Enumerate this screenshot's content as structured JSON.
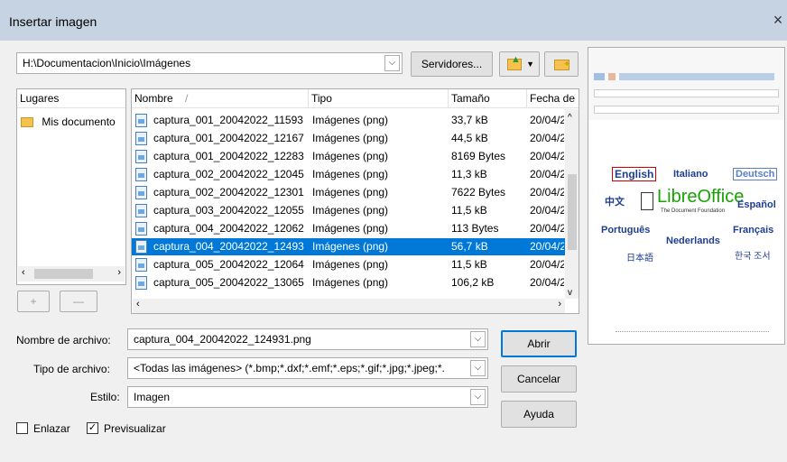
{
  "window": {
    "title": "Insertar imagen",
    "close_glyph": "×"
  },
  "path": {
    "value": "H:\\Documentacion\\Inicio\\Imágenes",
    "servers_button": "Servidores..."
  },
  "places": {
    "header": "Lugares",
    "items": [
      "Mis documento"
    ],
    "add": "+",
    "remove": "—"
  },
  "files": {
    "columns": {
      "name": "Nombre",
      "sort_glyph": "/",
      "type": "Tipo",
      "size": "Tamaño",
      "date": "Fecha de r"
    },
    "rows": [
      {
        "name": "captura_001_20042022_11593",
        "type": "Imágenes (png)",
        "size": "33,7 kB",
        "date": "20/04/2"
      },
      {
        "name": "captura_001_20042022_12167",
        "type": "Imágenes (png)",
        "size": "44,5 kB",
        "date": "20/04/2"
      },
      {
        "name": "captura_001_20042022_12283",
        "type": "Imágenes (png)",
        "size": "8169 Bytes",
        "date": "20/04/2"
      },
      {
        "name": "captura_002_20042022_12045",
        "type": "Imágenes (png)",
        "size": "11,3 kB",
        "date": "20/04/2"
      },
      {
        "name": "captura_002_20042022_12301",
        "type": "Imágenes (png)",
        "size": "7622 Bytes",
        "date": "20/04/2"
      },
      {
        "name": "captura_003_20042022_12055",
        "type": "Imágenes (png)",
        "size": "11,5 kB",
        "date": "20/04/2"
      },
      {
        "name": "captura_004_20042022_12062",
        "type": "Imágenes (png)",
        "size": "113 Bytes",
        "date": "20/04/2"
      },
      {
        "name": "captura_004_20042022_12493",
        "type": "Imágenes (png)",
        "size": "56,7 kB",
        "date": "20/04/2"
      },
      {
        "name": "captura_005_20042022_12064",
        "type": "Imágenes (png)",
        "size": "11,5 kB",
        "date": "20/04/2"
      },
      {
        "name": "captura_005_20042022_13065",
        "type": "Imágenes (png)",
        "size": "106,2 kB",
        "date": "20/04/2"
      }
    ],
    "selected_index": 7
  },
  "form": {
    "filename_label": "Nombre de archivo:",
    "filename_value": "captura_004_20042022_124931.png",
    "type_label": "Tipo de archivo:",
    "type_value": "<Todas las imágenes> (*.bmp;*.dxf;*.emf;*.eps;*.gif;*.jpg;*.jpeg;*.",
    "style_label": "Estilo:",
    "style_value": "Imagen",
    "link_label": "Enlazar",
    "link_checked": false,
    "preview_label": "Previsualizar",
    "preview_checked": true
  },
  "buttons": {
    "open": "Abrir",
    "cancel": "Cancelar",
    "help": "Ayuda"
  },
  "preview_image": {
    "words": [
      "English",
      "Italiano",
      "Deutsch",
      "中文",
      "LibreOffice",
      "The Document Foundation",
      "Español",
      "Português",
      "Nederlands",
      "Français",
      "日本語",
      "한국 조서"
    ]
  },
  "colors": {
    "selection": "#0078d7",
    "titlebar": "#c6d3e2",
    "libre_green": "#18a303"
  }
}
